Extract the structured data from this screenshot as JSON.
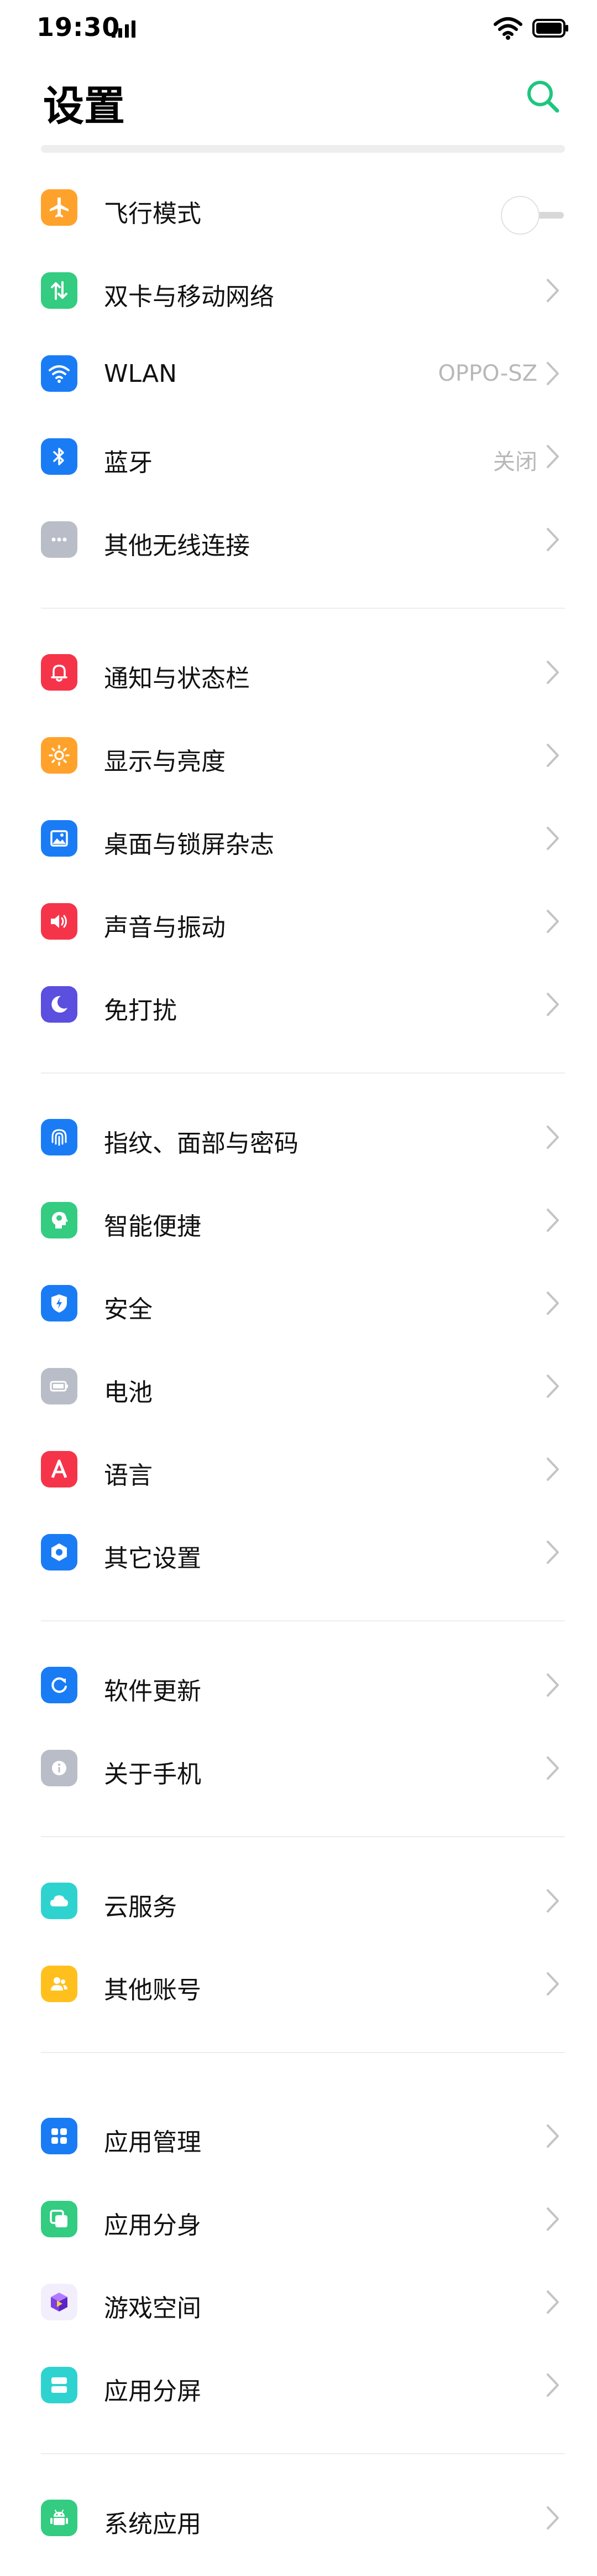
{
  "status_bar": {
    "time": "19:30"
  },
  "header": {
    "title": "设置"
  },
  "colors": {
    "accent": "#1ec67e",
    "chevron": "#c4c4c4",
    "value_text": "#b8b8b8"
  },
  "settings": {
    "airplane_mode": {
      "label": "飞行模式",
      "enabled": false,
      "icon": "airplane-icon"
    },
    "dual_sim": {
      "label": "双卡与移动网络",
      "icon": "data-arrows-icon"
    },
    "wlan": {
      "label": "WLAN",
      "value": "OPPO-SZ",
      "icon": "wifi-icon"
    },
    "bluetooth": {
      "label": "蓝牙",
      "value": "关闭",
      "icon": "bluetooth-icon"
    },
    "other_wireless": {
      "label": "其他无线连接",
      "icon": "more-dots-icon"
    },
    "notifications": {
      "label": "通知与状态栏",
      "icon": "bell-icon"
    },
    "display": {
      "label": "显示与亮度",
      "icon": "brightness-icon"
    },
    "wallpaper": {
      "label": "桌面与锁屏杂志",
      "icon": "picture-icon"
    },
    "sound": {
      "label": "声音与振动",
      "icon": "speaker-icon"
    },
    "dnd": {
      "label": "免打扰",
      "icon": "moon-icon"
    },
    "biometrics": {
      "label": "指纹、面部与密码",
      "icon": "fingerprint-icon"
    },
    "smart": {
      "label": "智能便捷",
      "icon": "smart-head-icon"
    },
    "security": {
      "label": "安全",
      "icon": "shield-icon"
    },
    "battery": {
      "label": "电池",
      "icon": "battery-icon"
    },
    "language": {
      "label": "语言",
      "icon": "letter-a-icon"
    },
    "other_settings": {
      "label": "其它设置",
      "icon": "hexagon-gear-icon"
    },
    "software_update": {
      "label": "软件更新",
      "icon": "update-icon"
    },
    "about": {
      "label": "关于手机",
      "icon": "info-icon"
    },
    "cloud": {
      "label": "云服务",
      "icon": "cloud-icon"
    },
    "accounts": {
      "label": "其他账号",
      "icon": "accounts-icon"
    },
    "app_manage": {
      "label": "应用管理",
      "icon": "apps-grid-icon"
    },
    "app_clone": {
      "label": "应用分身",
      "icon": "clone-icon"
    },
    "game_space": {
      "label": "游戏空间",
      "icon": "game-cube-icon"
    },
    "split_screen": {
      "label": "应用分屏",
      "icon": "split-screen-icon"
    },
    "system_apps": {
      "label": "系统应用",
      "icon": "android-icon"
    }
  }
}
